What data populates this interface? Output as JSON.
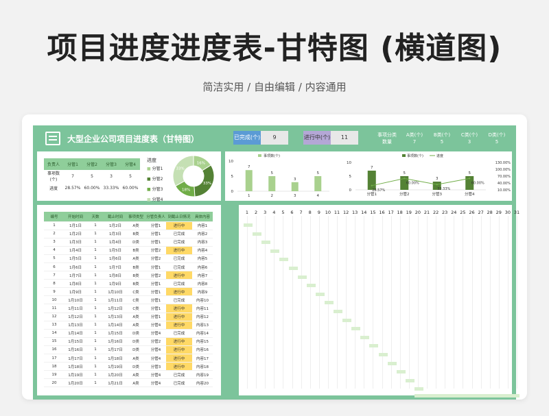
{
  "hero": {
    "title": "项目进度进度表-甘特图 (横道图)",
    "subtitle": "简洁实用 / 自由编辑 / 内容通用"
  },
  "sheet": {
    "title": "大型企业公司项目进度表（甘特图）",
    "done_label": "已完成(个)",
    "done_value": "9",
    "prog_label": "进行中(个)",
    "prog_value": "11",
    "groups": [
      {
        "label": "事项分类",
        "sub": "数量"
      },
      {
        "label": "A类(个)",
        "sub": "7"
      },
      {
        "label": "B类(个)",
        "sub": "5"
      },
      {
        "label": "C类(个)",
        "sub": "3"
      },
      {
        "label": "D类(个)",
        "sub": "5"
      }
    ]
  },
  "summary": {
    "headers": [
      "负责人",
      "分管1",
      "分管2",
      "分管3",
      "分管4"
    ],
    "rows": [
      [
        "事项数(个)",
        "7",
        "5",
        "3",
        "5"
      ],
      [
        "进度",
        "28.57%",
        "60.00%",
        "33.33%",
        "60.00%"
      ]
    ],
    "donut_title": "进度",
    "donut_legend": [
      "分管1",
      "分管2",
      "分管3",
      "分管4"
    ],
    "donut_labels": [
      "16%",
      "33%",
      "18%",
      "33%"
    ],
    "donut_values": [
      16,
      33,
      18,
      33
    ],
    "colors": [
      "#a9d18e",
      "#548235",
      "#70ad47",
      "#c5e0b4"
    ]
  },
  "chart_data": [
    {
      "type": "bar",
      "legend": "事项数(个)",
      "categories": [
        "1",
        "2",
        "3",
        "4"
      ],
      "values": [
        7,
        5,
        3,
        5
      ],
      "yticks": [
        "10",
        "5",
        "0"
      ],
      "ylim": [
        0,
        10
      ]
    },
    {
      "type": "bar",
      "legend": [
        "事项数(个)",
        "进度"
      ],
      "categories": [
        "分管1",
        "分管2",
        "分管3",
        "分管4"
      ],
      "series": [
        {
          "name": "事项数(个)",
          "values": [
            7,
            5,
            3,
            5
          ]
        },
        {
          "name": "进度",
          "values": [
            28.57,
            60.0,
            33.33,
            60.0
          ]
        }
      ],
      "bar_labels": [
        "7",
        "5",
        "3",
        "5"
      ],
      "line_labels": [
        "28.57%",
        "60.00%",
        "33.33%",
        "60.00%"
      ],
      "yticks_left": [
        "10",
        "5",
        "0"
      ],
      "yticks_right": [
        "130.00%",
        "100.00%",
        "70.00%",
        "40.00%",
        "10.00%"
      ]
    }
  ],
  "tasks": {
    "headers": [
      "编号",
      "开始时间",
      "天数",
      "截止时间",
      "事项类型",
      "分管负责人",
      "到截止日情况",
      "具体内容"
    ],
    "rows": [
      [
        "1",
        "1月1日",
        "1",
        "1月2日",
        "A类",
        "分管1",
        "进行中",
        "内容1"
      ],
      [
        "2",
        "1月2日",
        "1",
        "1月3日",
        "B类",
        "分管1",
        "已完成",
        "内容2"
      ],
      [
        "3",
        "1月3日",
        "1",
        "1月4日",
        "D类",
        "分管1",
        "已完成",
        "内容3"
      ],
      [
        "4",
        "1月4日",
        "1",
        "1月5日",
        "B类",
        "分管2",
        "进行中",
        "内容4"
      ],
      [
        "5",
        "1月5日",
        "1",
        "1月6日",
        "A类",
        "分管2",
        "已完成",
        "内容5"
      ],
      [
        "6",
        "1月6日",
        "1",
        "1月7日",
        "B类",
        "分管1",
        "已完成",
        "内容6"
      ],
      [
        "7",
        "1月7日",
        "1",
        "1月8日",
        "B类",
        "分管2",
        "进行中",
        "内容7"
      ],
      [
        "8",
        "1月8日",
        "1",
        "1月9日",
        "B类",
        "分管1",
        "已完成",
        "内容8"
      ],
      [
        "9",
        "1月9日",
        "1",
        "1月10日",
        "C类",
        "分管1",
        "进行中",
        "内容9"
      ],
      [
        "10",
        "1月10日",
        "1",
        "1月11日",
        "C类",
        "分管1",
        "已完成",
        "内容10"
      ],
      [
        "11",
        "1月11日",
        "1",
        "1月12日",
        "C类",
        "分管1",
        "进行中",
        "内容11"
      ],
      [
        "12",
        "1月12日",
        "1",
        "1月13日",
        "A类",
        "分管1",
        "进行中",
        "内容12"
      ],
      [
        "13",
        "1月13日",
        "1",
        "1月14日",
        "A类",
        "分管4",
        "进行中",
        "内容13"
      ],
      [
        "14",
        "1月14日",
        "1",
        "1月15日",
        "D类",
        "分管4",
        "已完成",
        "内容14"
      ],
      [
        "15",
        "1月15日",
        "1",
        "1月16日",
        "D类",
        "分管2",
        "进行中",
        "内容15"
      ],
      [
        "16",
        "1月16日",
        "1",
        "1月17日",
        "D类",
        "分管4",
        "进行中",
        "内容16"
      ],
      [
        "17",
        "1月17日",
        "1",
        "1月18日",
        "A类",
        "分管4",
        "进行中",
        "内容17"
      ],
      [
        "18",
        "1月18日",
        "1",
        "1月19日",
        "D类",
        "分管3",
        "进行中",
        "内容18"
      ],
      [
        "19",
        "1月19日",
        "1",
        "1月20日",
        "A类",
        "分管4",
        "已完成",
        "内容19"
      ],
      [
        "20",
        "1月20日",
        "1",
        "1月21日",
        "A类",
        "分管4",
        "已完成",
        "内容20"
      ]
    ]
  },
  "gantt": {
    "days": [
      "1",
      "2",
      "3",
      "4",
      "5",
      "6",
      "7",
      "8",
      "9",
      "10",
      "11",
      "12",
      "13",
      "14",
      "15",
      "16",
      "17",
      "18",
      "19",
      "20",
      "21",
      "22",
      "23",
      "24",
      "25",
      "26",
      "27",
      "28",
      "29",
      "30",
      "31"
    ],
    "bar_color": "#d9efcf"
  }
}
